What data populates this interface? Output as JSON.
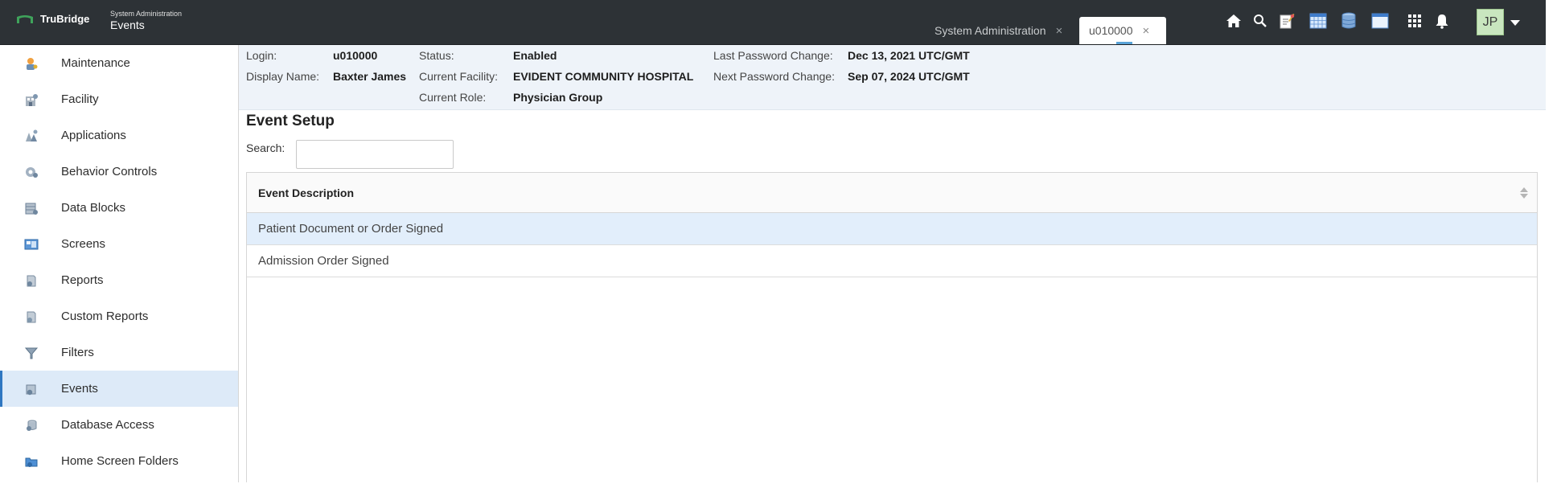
{
  "colors": {
    "topbar_bg": "#2d3236",
    "active_item_bg": "#ddeaf8",
    "active_item_accent": "#2f77c1",
    "info_bg": "#eef3f9",
    "selected_row_bg": "#e2eefb",
    "avatar_bg": "#c9e6bf"
  },
  "topbar": {
    "brand": "TruBridge",
    "brand_icon": "trubridge-logo",
    "breadcrumb_section": "System Administration",
    "breadcrumb_page": "Events",
    "tabs": [
      {
        "label": "System Administration",
        "close": "×",
        "active": false
      },
      {
        "label": "u010000",
        "close": "×",
        "active": true
      }
    ],
    "icons": [
      "home-icon",
      "search-icon",
      "notepad-icon",
      "calendar-grid-icon",
      "database-icon",
      "window-icon",
      "apps-grid-icon",
      "bell-icon"
    ],
    "user_initials": "JP"
  },
  "sidebar": {
    "items": [
      {
        "label": "Maintenance",
        "icon": "maintenance-icon",
        "active": false
      },
      {
        "label": "Facility",
        "icon": "facility-icon",
        "active": false
      },
      {
        "label": "Applications",
        "icon": "applications-icon",
        "active": false
      },
      {
        "label": "Behavior Controls",
        "icon": "behavior-controls-icon",
        "active": false
      },
      {
        "label": "Data Blocks",
        "icon": "data-blocks-icon",
        "active": false
      },
      {
        "label": "Screens",
        "icon": "screens-icon",
        "active": false
      },
      {
        "label": "Reports",
        "icon": "reports-icon",
        "active": false
      },
      {
        "label": "Custom Reports",
        "icon": "custom-reports-icon",
        "active": false
      },
      {
        "label": "Filters",
        "icon": "filters-icon",
        "active": false
      },
      {
        "label": "Events",
        "icon": "events-icon",
        "active": true
      },
      {
        "label": "Database Access",
        "icon": "database-access-icon",
        "active": false
      },
      {
        "label": "Home Screen Folders",
        "icon": "home-screen-folders-icon",
        "active": false
      }
    ]
  },
  "user_info": {
    "login_label": "Login:",
    "login_value": "u010000",
    "display_name_label": "Display Name:",
    "display_name_value": "Baxter James",
    "status_label": "Status:",
    "status_value": "Enabled",
    "facility_label": "Current Facility:",
    "facility_value": "EVIDENT COMMUNITY HOSPITAL",
    "role_label": "Current Role:",
    "role_value": "Physician Group",
    "last_pw_label": "Last Password Change:",
    "last_pw_value": "Dec 13, 2021 UTC/GMT",
    "next_pw_label": "Next Password Change:",
    "next_pw_value": "Sep 07, 2024 UTC/GMT"
  },
  "main": {
    "title": "Event Setup",
    "search_label": "Search:",
    "search_value": "",
    "table": {
      "column_header": "Event Description",
      "rows": [
        {
          "description": "Patient Document or Order Signed",
          "selected": true
        },
        {
          "description": "Admission Order Signed",
          "selected": false
        }
      ]
    }
  }
}
